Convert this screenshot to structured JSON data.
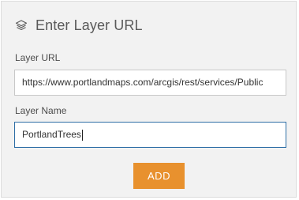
{
  "header": {
    "icon": "layers-icon",
    "title": "Enter Layer URL"
  },
  "form": {
    "url_label": "Layer URL",
    "url_value": "https://www.portlandmaps.com/arcgis/rest/services/Public",
    "name_label": "Layer Name",
    "name_value": "PortlandTrees"
  },
  "actions": {
    "add_label": "ADD"
  },
  "colors": {
    "panel_bg": "#f2f2f2",
    "accent_button": "#e8912e",
    "focus_border": "#2e6ea6"
  }
}
